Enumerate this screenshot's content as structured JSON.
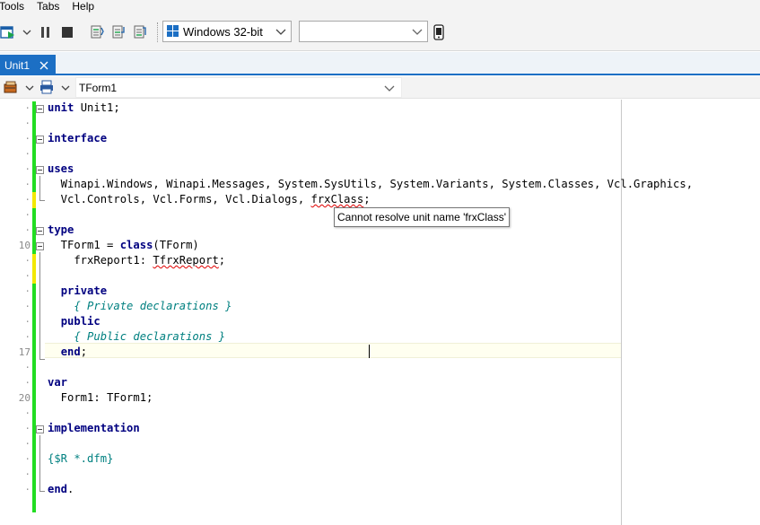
{
  "menubar": {
    "items": [
      "Tools",
      "Tabs",
      "Help"
    ]
  },
  "toolbar": {
    "platform_value": "Windows 32-bit",
    "config_value": ""
  },
  "tabs": [
    {
      "label": "Unit1",
      "active": true
    }
  ],
  "classbar": {
    "selected_class": "TForm1"
  },
  "editor": {
    "line_numbers": [
      {
        "line": 10,
        "label": "10"
      },
      {
        "line": 17,
        "label": "17"
      },
      {
        "line": 20,
        "label": "20"
      }
    ],
    "lines": [
      {
        "row": 1,
        "segments": [
          [
            "kw",
            "unit"
          ],
          [
            "t",
            " Unit1;"
          ]
        ]
      },
      {
        "row": 3,
        "segments": [
          [
            "kw",
            "interface"
          ]
        ]
      },
      {
        "row": 5,
        "segments": [
          [
            "kw",
            "uses"
          ]
        ]
      },
      {
        "row": 6,
        "segments": [
          [
            "t",
            "  Winapi.Windows, Winapi.Messages, System.SysUtils, System.Variants, System.Classes, Vcl.Graphics,"
          ]
        ]
      },
      {
        "row": 7,
        "segments": [
          [
            "t",
            "  Vcl.Controls, Vcl.Forms, Vcl.Dialogs, "
          ],
          [
            "err",
            "frxClass"
          ],
          [
            "t",
            ";"
          ]
        ]
      },
      {
        "row": 9,
        "segments": [
          [
            "kw",
            "type"
          ]
        ]
      },
      {
        "row": 10,
        "segments": [
          [
            "t",
            "  TForm1 = "
          ],
          [
            "kw",
            "class"
          ],
          [
            "t",
            "(TForm)"
          ]
        ]
      },
      {
        "row": 11,
        "segments": [
          [
            "t",
            "    frxReport1: "
          ],
          [
            "err",
            "TfrxReport"
          ],
          [
            "t",
            ";"
          ]
        ]
      },
      {
        "row": 13,
        "segments": [
          [
            "t",
            "  "
          ],
          [
            "kw",
            "private"
          ]
        ]
      },
      {
        "row": 14,
        "segments": [
          [
            "t",
            "    "
          ],
          [
            "cm",
            "{ Private declarations }"
          ]
        ]
      },
      {
        "row": 15,
        "segments": [
          [
            "t",
            "  "
          ],
          [
            "kw",
            "public"
          ]
        ]
      },
      {
        "row": 16,
        "segments": [
          [
            "t",
            "    "
          ],
          [
            "cm",
            "{ Public declarations }"
          ]
        ]
      },
      {
        "row": 17,
        "segments": [
          [
            "t",
            "  "
          ],
          [
            "kw",
            "end"
          ],
          [
            "t",
            ";"
          ]
        ]
      },
      {
        "row": 19,
        "segments": [
          [
            "kw",
            "var"
          ]
        ]
      },
      {
        "row": 20,
        "segments": [
          [
            "t",
            "  Form1: TForm1;"
          ]
        ]
      },
      {
        "row": 22,
        "segments": [
          [
            "kw",
            "implementation"
          ]
        ]
      },
      {
        "row": 24,
        "segments": [
          [
            "dir",
            "{$R *.dfm}"
          ]
        ]
      },
      {
        "row": 26,
        "segments": [
          [
            "kw",
            "end"
          ],
          [
            "t",
            "."
          ]
        ]
      }
    ],
    "tooltip": "Cannot resolve unit name 'frxClass'"
  },
  "colors": {
    "tab_active": "#1c6fc4",
    "keyword": "#000080",
    "comment": "#008080",
    "change_saved": "#22dd22",
    "change_modified": "#f2e800",
    "error_underline": "#e00000"
  }
}
